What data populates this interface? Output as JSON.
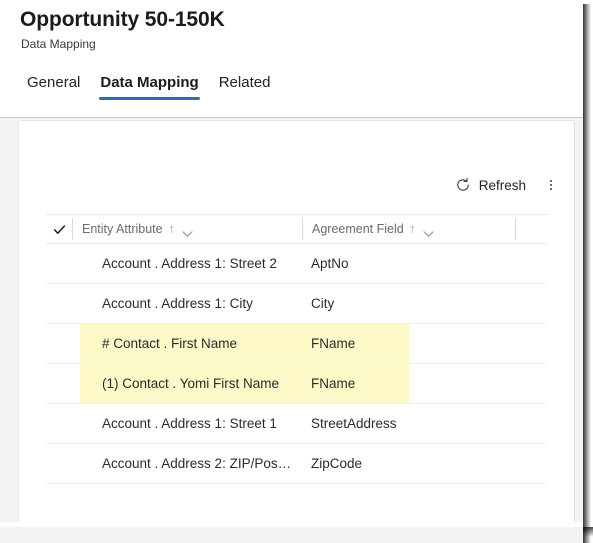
{
  "header": {
    "title": "Opportunity 50-150K",
    "subtitle": "Data Mapping",
    "tabs": [
      {
        "label": "General",
        "active": false
      },
      {
        "label": "Data Mapping",
        "active": true
      },
      {
        "label": "Related",
        "active": false
      }
    ],
    "accent_color": "#2b6cb8"
  },
  "commandbar": {
    "refresh_label": "Refresh",
    "refresh_icon": "refresh-circular-arrow-icon",
    "overflow_icon": "more-vertical-icon"
  },
  "grid": {
    "select_all_icon": "checkmark-icon",
    "columns": [
      {
        "label": "Entity Attribute",
        "sort_icon": "arrow-up-icon",
        "menu_icon": "chevron-down-icon"
      },
      {
        "label": "Agreement Field",
        "sort_icon": "arrow-up-icon",
        "menu_icon": "chevron-down-icon"
      }
    ],
    "highlight_color": "#fcf8c8",
    "rows": [
      {
        "entity_attribute": "Account . Address 1: Street 2",
        "agreement_field": "AptNo",
        "highlighted": false
      },
      {
        "entity_attribute": "Account . Address 1: City",
        "agreement_field": "City",
        "highlighted": false
      },
      {
        "entity_attribute": "# Contact . First Name",
        "agreement_field": "FName",
        "highlighted": true
      },
      {
        "entity_attribute": "(1) Contact . Yomi First Name",
        "agreement_field": "FName",
        "highlighted": true
      },
      {
        "entity_attribute": "Account . Address 1: Street 1",
        "agreement_field": "StreetAddress",
        "highlighted": false
      },
      {
        "entity_attribute": "Account . Address 2: ZIP/Pos…",
        "agreement_field": "ZipCode",
        "highlighted": false
      }
    ]
  }
}
